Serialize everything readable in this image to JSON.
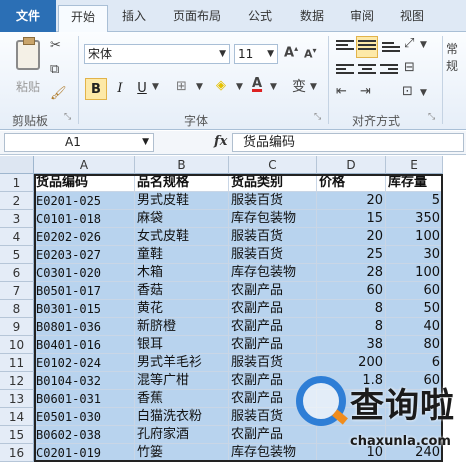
{
  "ribbon": {
    "tabs": [
      "文件",
      "开始",
      "插入",
      "页面布局",
      "公式",
      "数据",
      "审阅",
      "视图"
    ],
    "paste_label": "粘贴",
    "font_name": "宋体",
    "font_size": "11",
    "style_label": "常规",
    "groups": [
      "剪贴板",
      "字体",
      "对齐方式"
    ]
  },
  "formula_bar": {
    "cell_ref": "A1",
    "fx": "fx",
    "content": "货品编码"
  },
  "sheet": {
    "columns": [
      "A",
      "B",
      "C",
      "D",
      "E"
    ],
    "rows": [
      {
        "n": "1",
        "a": "货品编码",
        "b": "品名规格",
        "c": "货品类别",
        "d": "价格",
        "e": "库存量"
      },
      {
        "n": "2",
        "a": "E0201-025",
        "b": "男式皮鞋",
        "c": "服装百货",
        "d": "20",
        "e": "5"
      },
      {
        "n": "3",
        "a": "C0101-018",
        "b": "麻袋",
        "c": "库存包装物",
        "d": "15",
        "e": "350"
      },
      {
        "n": "4",
        "a": "E0202-026",
        "b": "女式皮鞋",
        "c": "服装百货",
        "d": "20",
        "e": "100"
      },
      {
        "n": "5",
        "a": "E0203-027",
        "b": "童鞋",
        "c": "服装百货",
        "d": "25",
        "e": "30"
      },
      {
        "n": "6",
        "a": "C0301-020",
        "b": "木箱",
        "c": "库存包装物",
        "d": "28",
        "e": "100"
      },
      {
        "n": "7",
        "a": "B0501-017",
        "b": "香菇",
        "c": "农副产品",
        "d": "60",
        "e": "60"
      },
      {
        "n": "8",
        "a": "B0301-015",
        "b": "黄花",
        "c": "农副产品",
        "d": "8",
        "e": "50"
      },
      {
        "n": "9",
        "a": "B0801-036",
        "b": "新脐橙",
        "c": "农副产品",
        "d": "8",
        "e": "40"
      },
      {
        "n": "10",
        "a": "B0401-016",
        "b": "银耳",
        "c": "农副产品",
        "d": "38",
        "e": "80"
      },
      {
        "n": "11",
        "a": "E0102-024",
        "b": "男式羊毛衫",
        "c": "服装百货",
        "d": "200",
        "e": "6"
      },
      {
        "n": "12",
        "a": "B0104-032",
        "b": "混等广柑",
        "c": "农副产品",
        "d": "1.8",
        "e": "60"
      },
      {
        "n": "13",
        "a": "B0601-031",
        "b": "香蕉",
        "c": "农副产品",
        "d": "",
        "e": ""
      },
      {
        "n": "14",
        "a": "E0501-030",
        "b": "白猫洗衣粉",
        "c": "服装百货",
        "d": "",
        "e": ""
      },
      {
        "n": "15",
        "a": "B0602-038",
        "b": "孔府家酒",
        "c": "农副产品",
        "d": "",
        "e": ""
      },
      {
        "n": "16",
        "a": "C0201-019",
        "b": "竹篓",
        "c": "库存包装物",
        "d": "10",
        "e": "240"
      }
    ]
  },
  "watermark": {
    "text": "查询啦",
    "url": "chaxunla.com"
  }
}
